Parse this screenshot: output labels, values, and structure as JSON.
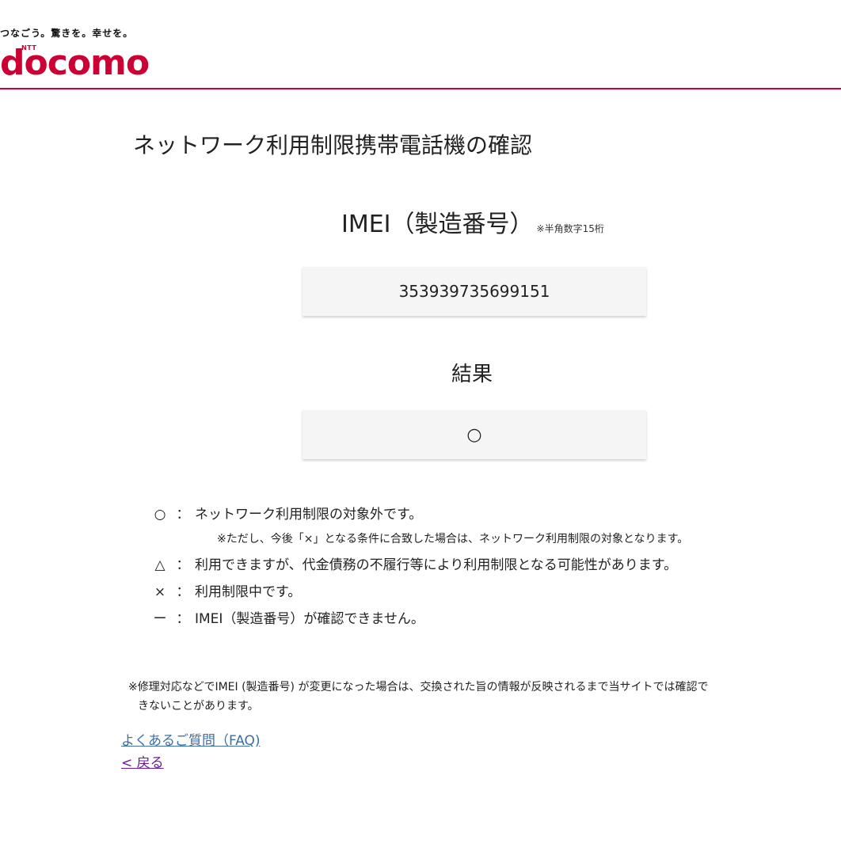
{
  "header": {
    "tagline": "つなごう。驚きを。幸せを。",
    "logo_ntt": "NTT",
    "logo_text": "docomo"
  },
  "page_title": "ネットワーク利用制限携帯電話機の確認",
  "imei": {
    "label": "IMEI（製造番号）",
    "note": "※半角数字15桁",
    "value": "353939735699151"
  },
  "result": {
    "label": "結果",
    "value": "○"
  },
  "legend": {
    "rows": [
      {
        "symbol": "○",
        "text": "ネットワーク利用制限の対象外です。"
      },
      {
        "symbol": "△",
        "text": "利用できますが、代金債務の不履行等により利用制限となる可能性があります。"
      },
      {
        "symbol": "×",
        "text": "利用制限中です。"
      },
      {
        "symbol": "ー",
        "text": "IMEI（製造番号）が確認できません。"
      }
    ],
    "colon": "：",
    "note_after_first": "※ただし、今後「×」となる条件に合致した場合は、ネットワーク利用制限の対象となります。"
  },
  "footnote": {
    "line1": "※修理対応などでIMEI (製造番号) が変更になった場合は、交換された旨の情報が反映されるまで当サイトでは確認で",
    "line2": "きないことがあります。"
  },
  "links": {
    "faq": "よくあるご質問（FAQ)",
    "back": "< 戻る"
  },
  "colors": {
    "brand": "#cc0033",
    "link": "#3a6fa8",
    "visited_link": "#6a1b9a"
  }
}
